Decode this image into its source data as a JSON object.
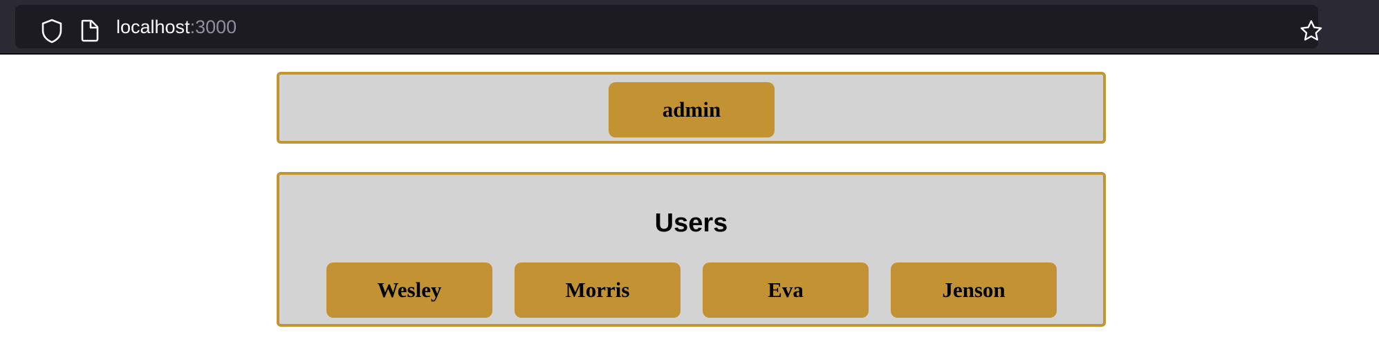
{
  "browser": {
    "url_host": "localhost",
    "url_port": ":3000",
    "icons": [
      "shield-icon",
      "page-icon",
      "star-icon"
    ]
  },
  "admin_panel": {
    "button_label": "admin"
  },
  "users_panel": {
    "title": "Users",
    "users": [
      {
        "name": "Wesley"
      },
      {
        "name": "Morris"
      },
      {
        "name": "Eva"
      },
      {
        "name": "Jenson"
      }
    ]
  },
  "colors": {
    "accent": "#c39333",
    "panel_bg": "#d3d3d3",
    "border": "#c3942f"
  }
}
